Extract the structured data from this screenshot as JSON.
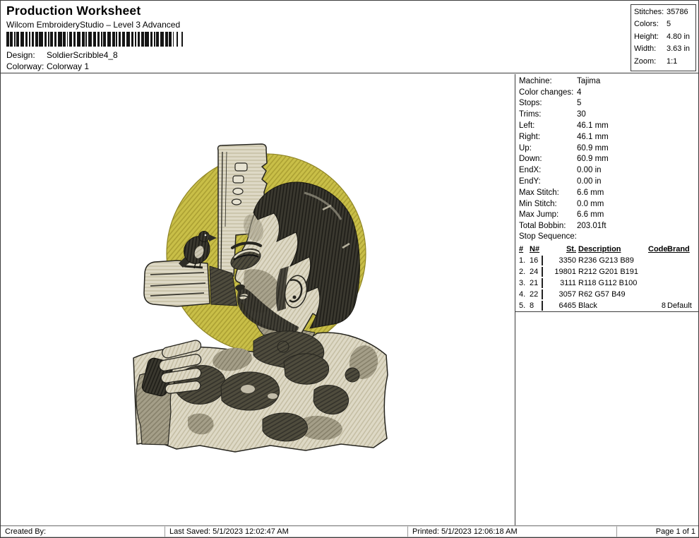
{
  "header": {
    "title": "Production Worksheet",
    "subtitle": "Wilcom EmbroideryStudio – Level 3 Advanced",
    "design_label": "Design:",
    "design_value": "SoldierScribble4_8",
    "colorway_label": "Colorway:",
    "colorway_value": "Colorway 1",
    "barcode_pattern": "212111213121112121312111212131211121213121113121211121312111212131211121213121112131212112131"
  },
  "stats_box": {
    "rows": [
      {
        "label": "Stitches:",
        "value": "35786"
      },
      {
        "label": "Colors:",
        "value": "5"
      },
      {
        "label": "Height:",
        "value": "4.80 in"
      },
      {
        "label": "Width:",
        "value": "3.63 in"
      },
      {
        "label": "Zoom:",
        "value": "1:1"
      }
    ]
  },
  "machine_panel": {
    "rows": [
      {
        "label": "Machine:",
        "value": "Tajima"
      },
      {
        "label": "Color changes:",
        "value": "4"
      },
      {
        "label": "Stops:",
        "value": "5"
      },
      {
        "label": "Trims:",
        "value": "30"
      },
      {
        "label": "Left:",
        "value": "46.1 mm"
      },
      {
        "label": "Right:",
        "value": "46.1 mm"
      },
      {
        "label": "Up:",
        "value": "60.9 mm"
      },
      {
        "label": "Down:",
        "value": "60.9 mm"
      },
      {
        "label": "EndX:",
        "value": "0.00 in"
      },
      {
        "label": "EndY:",
        "value": "0.00 in"
      },
      {
        "label": "Max Stitch:",
        "value": "6.6 mm"
      },
      {
        "label": "Min Stitch:",
        "value": "0.0 mm"
      },
      {
        "label": "Max Jump:",
        "value": "6.6 mm"
      },
      {
        "label": "Total Bobbin:",
        "value": "203.01ft"
      }
    ]
  },
  "stop_sequence": {
    "title": "Stop Sequence:",
    "columns": [
      "#",
      "N#",
      "",
      "St.",
      "Description",
      "Code",
      "Brand"
    ],
    "rows": [
      {
        "num": "1.",
        "n": "16",
        "swatch": "#ECD559",
        "st": "3350",
        "description": "R236 G213 B89",
        "code": "",
        "brand": ""
      },
      {
        "num": "2.",
        "n": "24",
        "swatch": "#D4C9BF",
        "st": "19801",
        "description": "R212 G201 B191",
        "code": "",
        "brand": ""
      },
      {
        "num": "3.",
        "n": "21",
        "swatch": "#767064",
        "st": "3111",
        "description": "R118 G112 B100",
        "code": "",
        "brand": ""
      },
      {
        "num": "4.",
        "n": "22",
        "swatch": "#3E3931",
        "st": "3057",
        "description": "R62 G57 B49",
        "code": "",
        "brand": ""
      },
      {
        "num": "5.",
        "n": "8",
        "swatch": "#000000",
        "st": "6465",
        "description": "Black",
        "code": "8",
        "brand": "Default"
      }
    ]
  },
  "footer": {
    "created_by": "Created By:",
    "last_saved": "Last Saved: 5/1/2023 12:02:47 AM",
    "printed": "Printed: 5/1/2023 12:06:18 AM",
    "page": "Page 1 of 1"
  },
  "design": {
    "description": "Soldier scribble embroidery design with bird on rifle and yellow circle background",
    "colors": {
      "yellow": "#C9BF48",
      "tan": "#DED9C6",
      "mid": "#A49E88",
      "dark": "#4F4C3D",
      "hair": "#3A382F",
      "outline": "#26251F"
    }
  }
}
